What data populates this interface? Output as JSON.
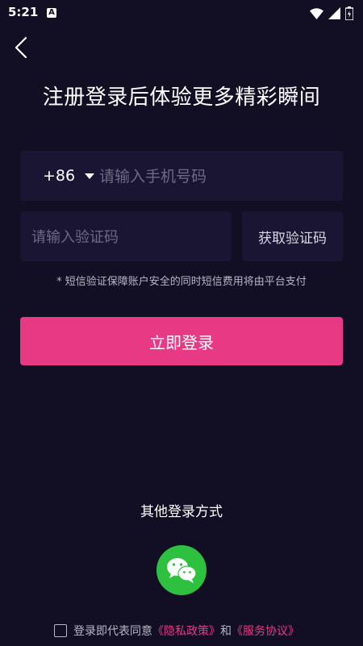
{
  "status_bar": {
    "time": "5:21",
    "notification_letter": "A",
    "icons": [
      "wifi-icon",
      "signal-icon",
      "battery-icon"
    ]
  },
  "header": {
    "back_icon": "chevron-left-icon",
    "title": "注册登录后体验更多精彩瞬间"
  },
  "form": {
    "country_code": "+86",
    "phone_placeholder": "请输入手机号码",
    "phone_value": "",
    "code_placeholder": "请输入验证码",
    "code_value": "",
    "get_code_label": "获取验证码",
    "sms_note": "* 短信验证保障账户安全的同时短信费用将由平台支付",
    "login_label": "立即登录"
  },
  "other_login": {
    "title": "其他登录方式",
    "wechat_icon": "wechat-icon"
  },
  "agreement": {
    "prefix": "登录即代表同意",
    "privacy_link": "《隐私政策》",
    "conjunction": "和",
    "terms_link": "《服务协议》",
    "checked": false
  },
  "colors": {
    "background": "#120e24",
    "field": "#1a1533",
    "accent": "#e83a84",
    "wechat": "#2dc13f"
  }
}
